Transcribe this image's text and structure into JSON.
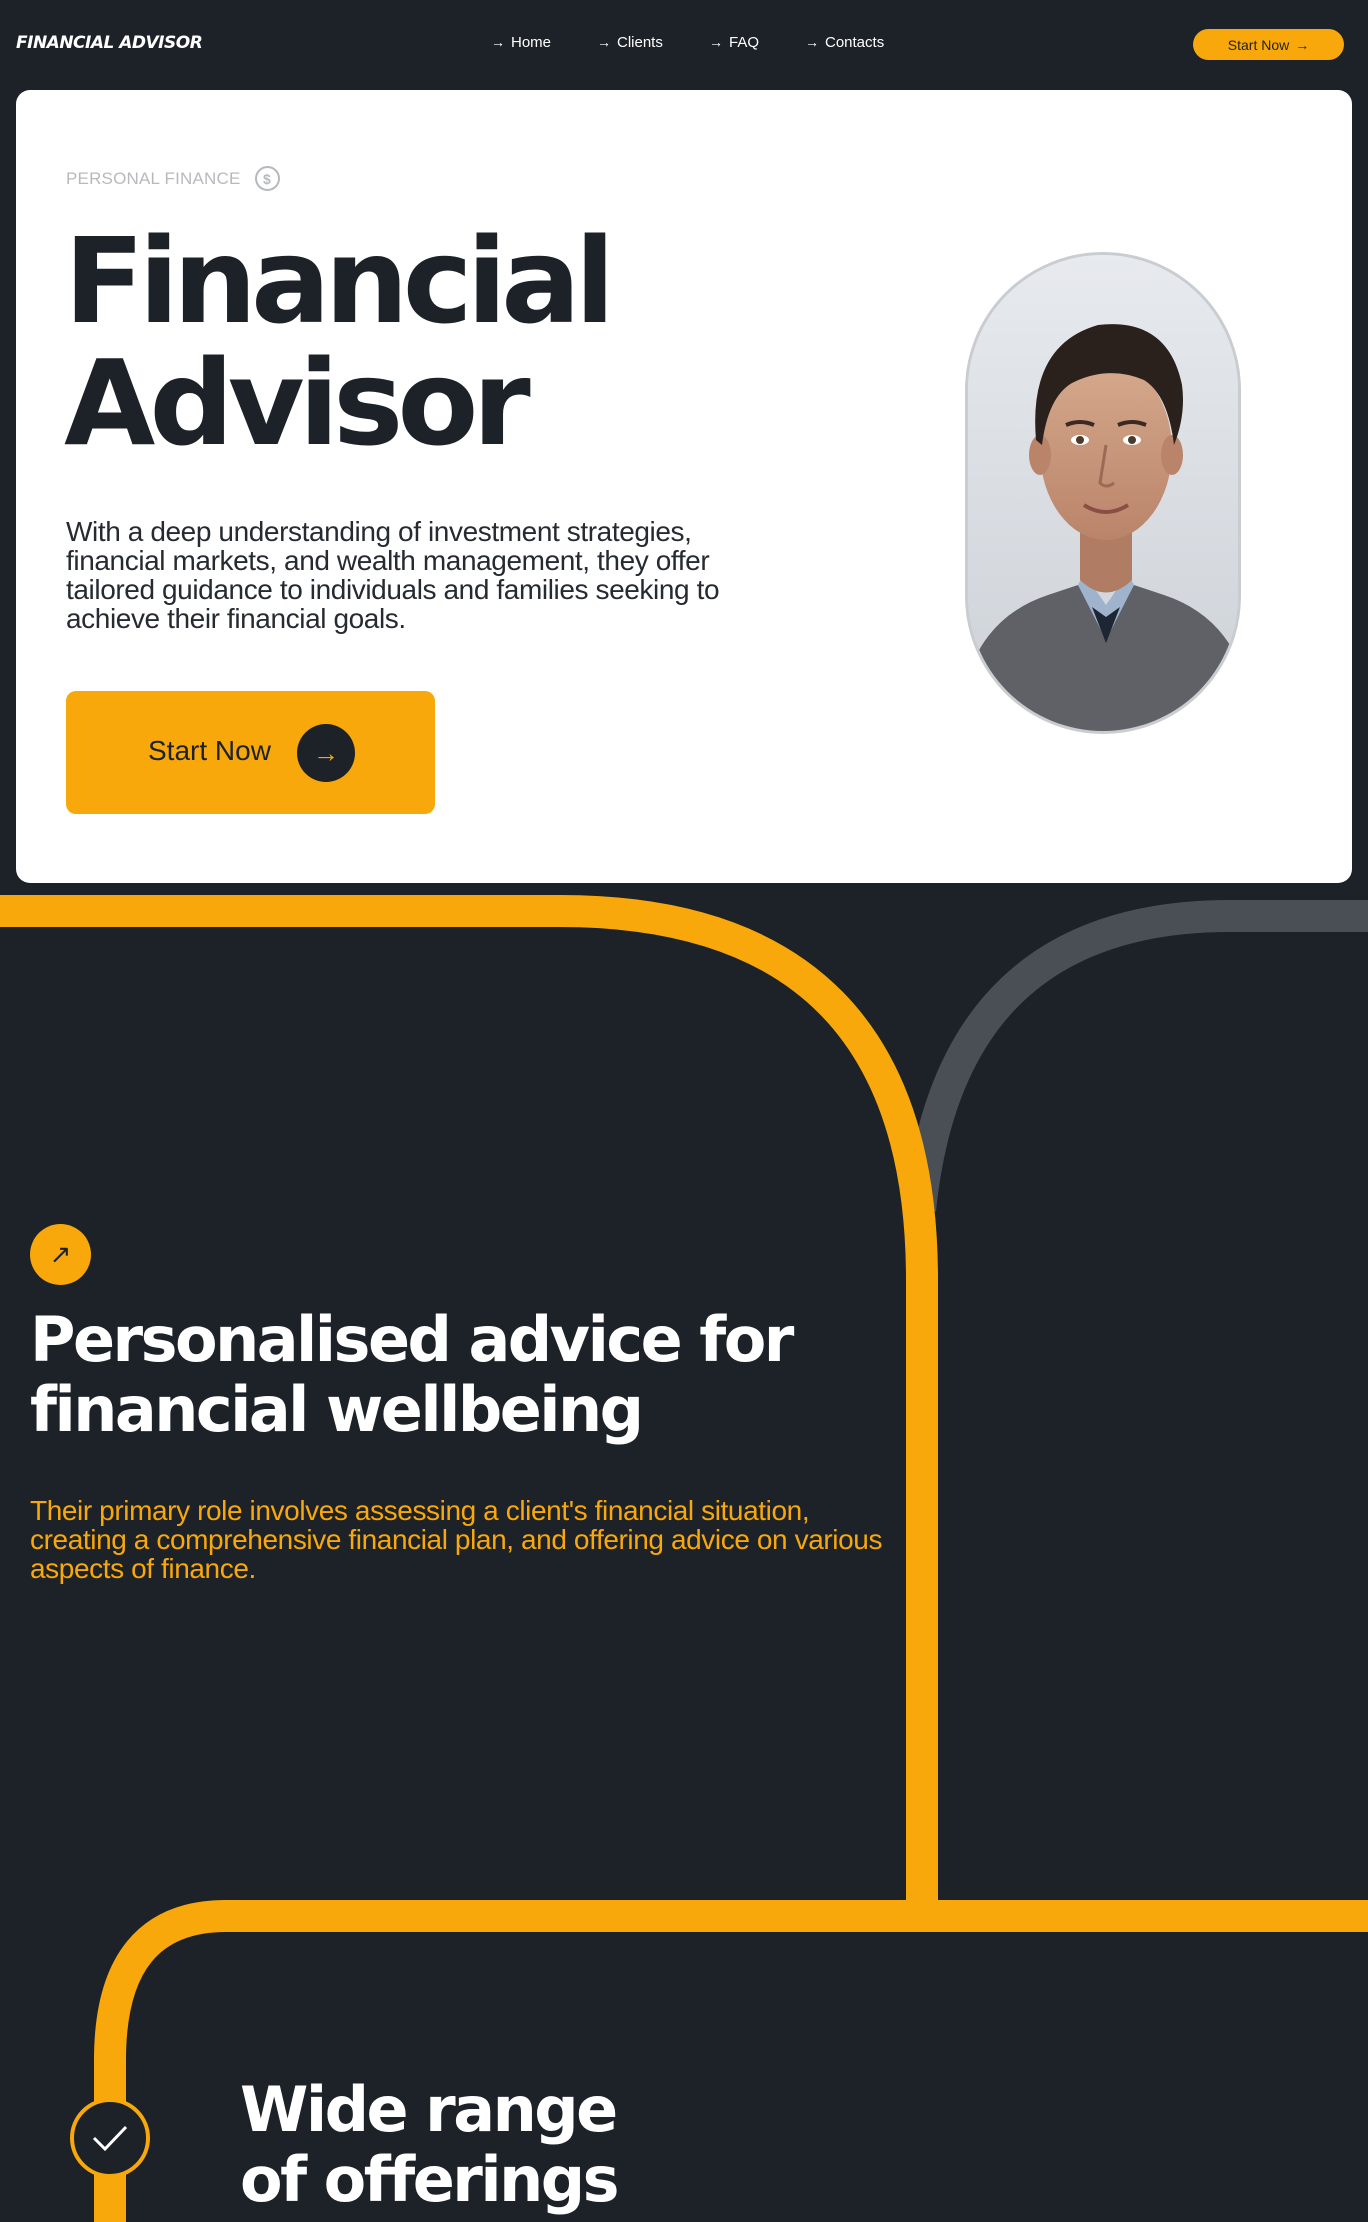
{
  "nav": {
    "brand": "FINANCIAL ADVISOR",
    "links": [
      {
        "arrow": "→",
        "label": "Home"
      },
      {
        "arrow": "→",
        "label": "Clients"
      },
      {
        "arrow": "→",
        "label": "FAQ"
      },
      {
        "arrow": "→",
        "label": "Contacts"
      }
    ],
    "cta_label": "Start Now",
    "cta_arrow": "→"
  },
  "hero": {
    "eyebrow": "PERSONAL FINANCE",
    "eyebrow_icon": "dollar-coin-icon",
    "title_line1": "Financial",
    "title_line2": "Advisor",
    "description": "With a deep understanding of investment strategies, financial markets, and wealth management, they offer tailored guidance to individuals and families seeking to achieve their financial goals.",
    "button_label": "Start Now",
    "button_icon": "→",
    "portrait": "advisor-portrait"
  },
  "section_personal": {
    "icon": "↗",
    "title_line1": "Personalised advice for",
    "title_line2": "financial wellbeing",
    "description": "Their primary role involves assessing a client's financial situation, creating a comprehensive financial plan, and offering advice on various aspects of finance."
  },
  "section_offerings": {
    "icon": "check-icon",
    "title_line1": "Wide range",
    "title_line2": "of offerings"
  },
  "colors": {
    "background": "#1d2229",
    "accent": "#f8a80a",
    "card": "#ffffff",
    "muted_curve": "#4a4f56"
  }
}
